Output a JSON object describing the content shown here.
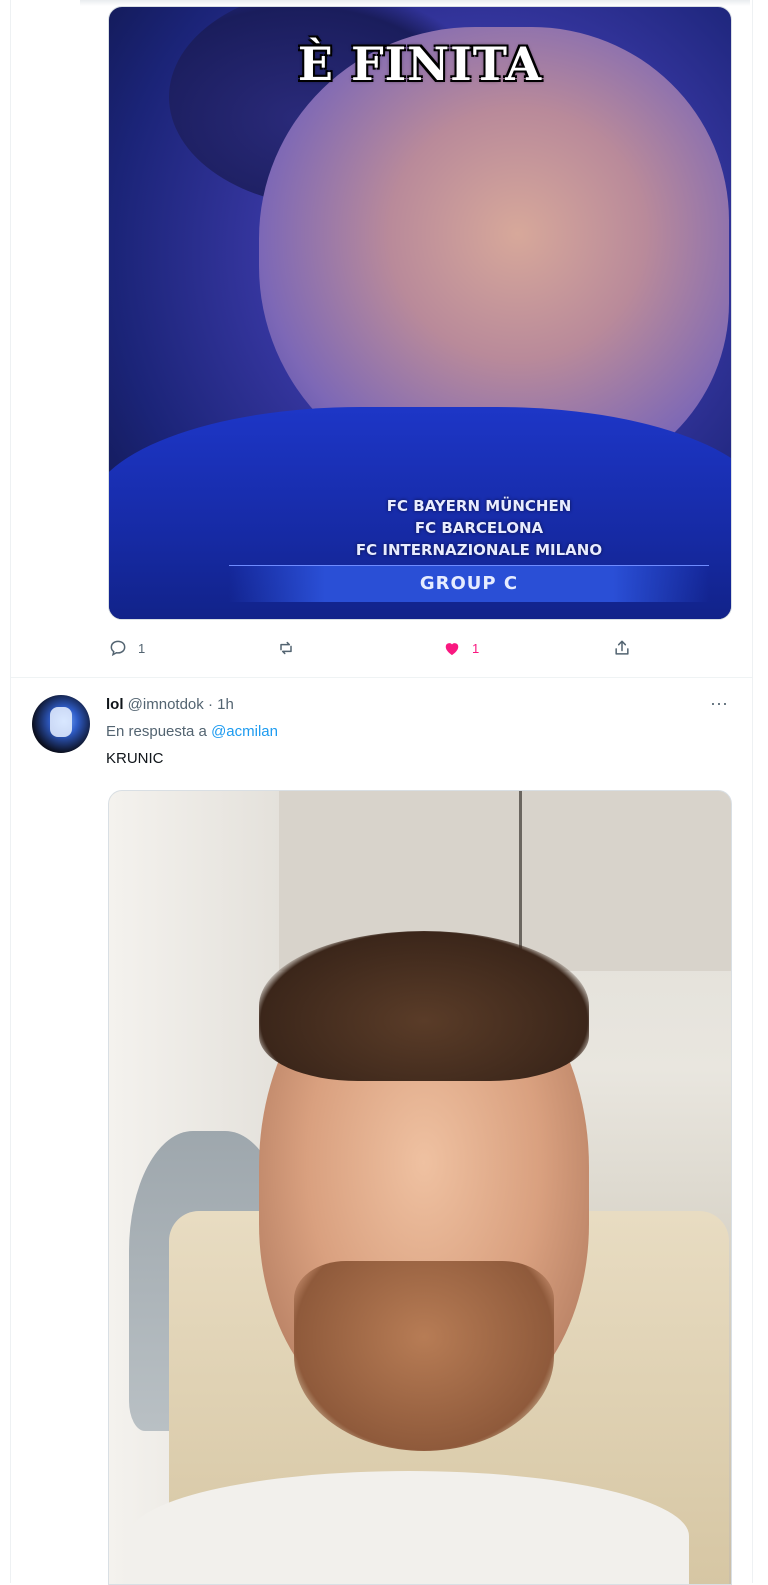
{
  "tweet1": {
    "media": {
      "title": "È FINITA",
      "caption_lines": [
        "FC BAYERN MÜNCHEN",
        "FC BARCELONA",
        "FC INTERNAZIONALE MILANO"
      ],
      "group_label": "GROUP C"
    },
    "actions": {
      "reply_count": "1",
      "retweet_count": "",
      "like_count": "1",
      "liked": true
    }
  },
  "tweet2": {
    "author_name": "lol",
    "author_handle": "@imnotdok",
    "separator": "·",
    "time": "1h",
    "reply_prefix": "En respuesta a",
    "reply_to": "@acmilan",
    "text": "KRUNIC",
    "more_label": "···"
  },
  "colors": {
    "like_pink": "#f91880",
    "link_blue": "#1d9bf0",
    "muted_gray": "#536471"
  }
}
